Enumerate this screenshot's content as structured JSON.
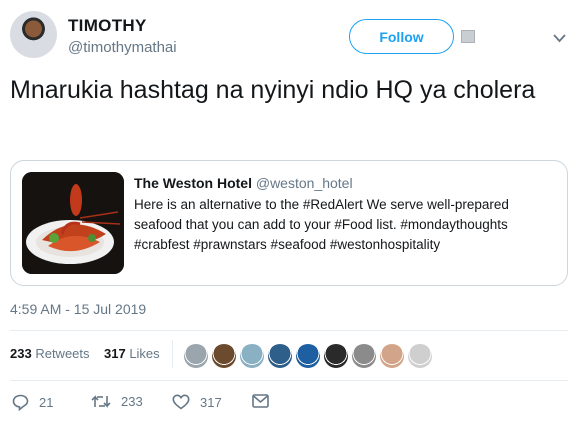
{
  "author": {
    "name": "TIMOTHY",
    "handle": "@timothymathai"
  },
  "follow_label": "Follow",
  "tweet_text": "Mnarukia hashtag na nyinyi ndio HQ ya cholera",
  "quote": {
    "name": "The Weston Hotel",
    "handle": "@weston_hotel",
    "text": "Here is an alternative to the #RedAlert We serve well-prepared seafood that you can add to your #Food list. #mondaythoughts #crabfest #prawnstars #seafood #westonhospitality"
  },
  "timestamp": "4:59 AM - 15 Jul 2019",
  "stats": {
    "retweets_count": "233",
    "retweets_label": "Retweets",
    "likes_count": "317",
    "likes_label": "Likes"
  },
  "liker_colors": [
    "#9aa5ad",
    "#6b4a2e",
    "#8ab0c4",
    "#2e5f8a",
    "#1d5fa0",
    "#2a2a2a",
    "#8b8b8b",
    "#d2a58a",
    "#cfcfcf"
  ],
  "actions": {
    "replies": "21",
    "retweets": "233",
    "likes": "317"
  },
  "icons": [
    "avatar",
    "chevron-down-icon",
    "reply-icon",
    "retweet-icon",
    "heart-icon",
    "message-icon"
  ]
}
